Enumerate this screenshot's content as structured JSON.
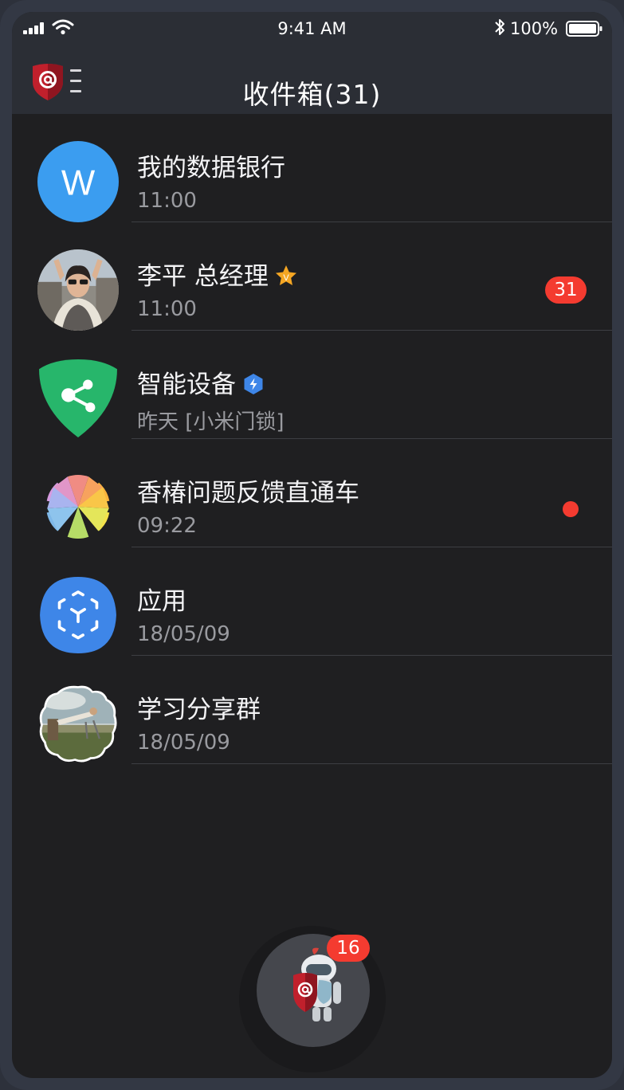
{
  "status_bar": {
    "time": "9:41 AM",
    "battery": "100%",
    "icons": [
      "signal-icon",
      "wifi-icon",
      "bluetooth-icon",
      "battery-icon"
    ]
  },
  "header": {
    "title": "收件箱(31)",
    "logo_icon": "shield-at-logo-icon",
    "menu_icon": "menu-icon"
  },
  "conversations": [
    {
      "name": "我的数据银行",
      "time": "11:00",
      "avatar_letter": "W",
      "avatar": "letter-avatar",
      "color": "#3b9df0"
    },
    {
      "name": "李平 总经理",
      "time": "11:00",
      "avatar": "photo-avatar",
      "title_badge": "V",
      "unread": "31"
    },
    {
      "name": "智能设备",
      "time": "昨天 [小米门锁]",
      "avatar": "share-shield-avatar",
      "color": "#27b66b",
      "title_badge_icon": "lightning-icon"
    },
    {
      "name": "香椿问题反馈直通车",
      "time": "09:22",
      "avatar": "flower-avatar",
      "unread_dot": true
    },
    {
      "name": "应用",
      "time": "18/05/09",
      "avatar": "app-cube-avatar",
      "color": "#3e86e8"
    },
    {
      "name": "学习分享群",
      "time": "18/05/09",
      "avatar": "group-photo-avatar"
    }
  ],
  "fab": {
    "badge": "16",
    "icon": "robot-assistant-icon"
  },
  "colors": {
    "background": "#1f1f21",
    "header": "#2b2e35",
    "badge": "#f43b30",
    "divider": "#3d3e43"
  }
}
